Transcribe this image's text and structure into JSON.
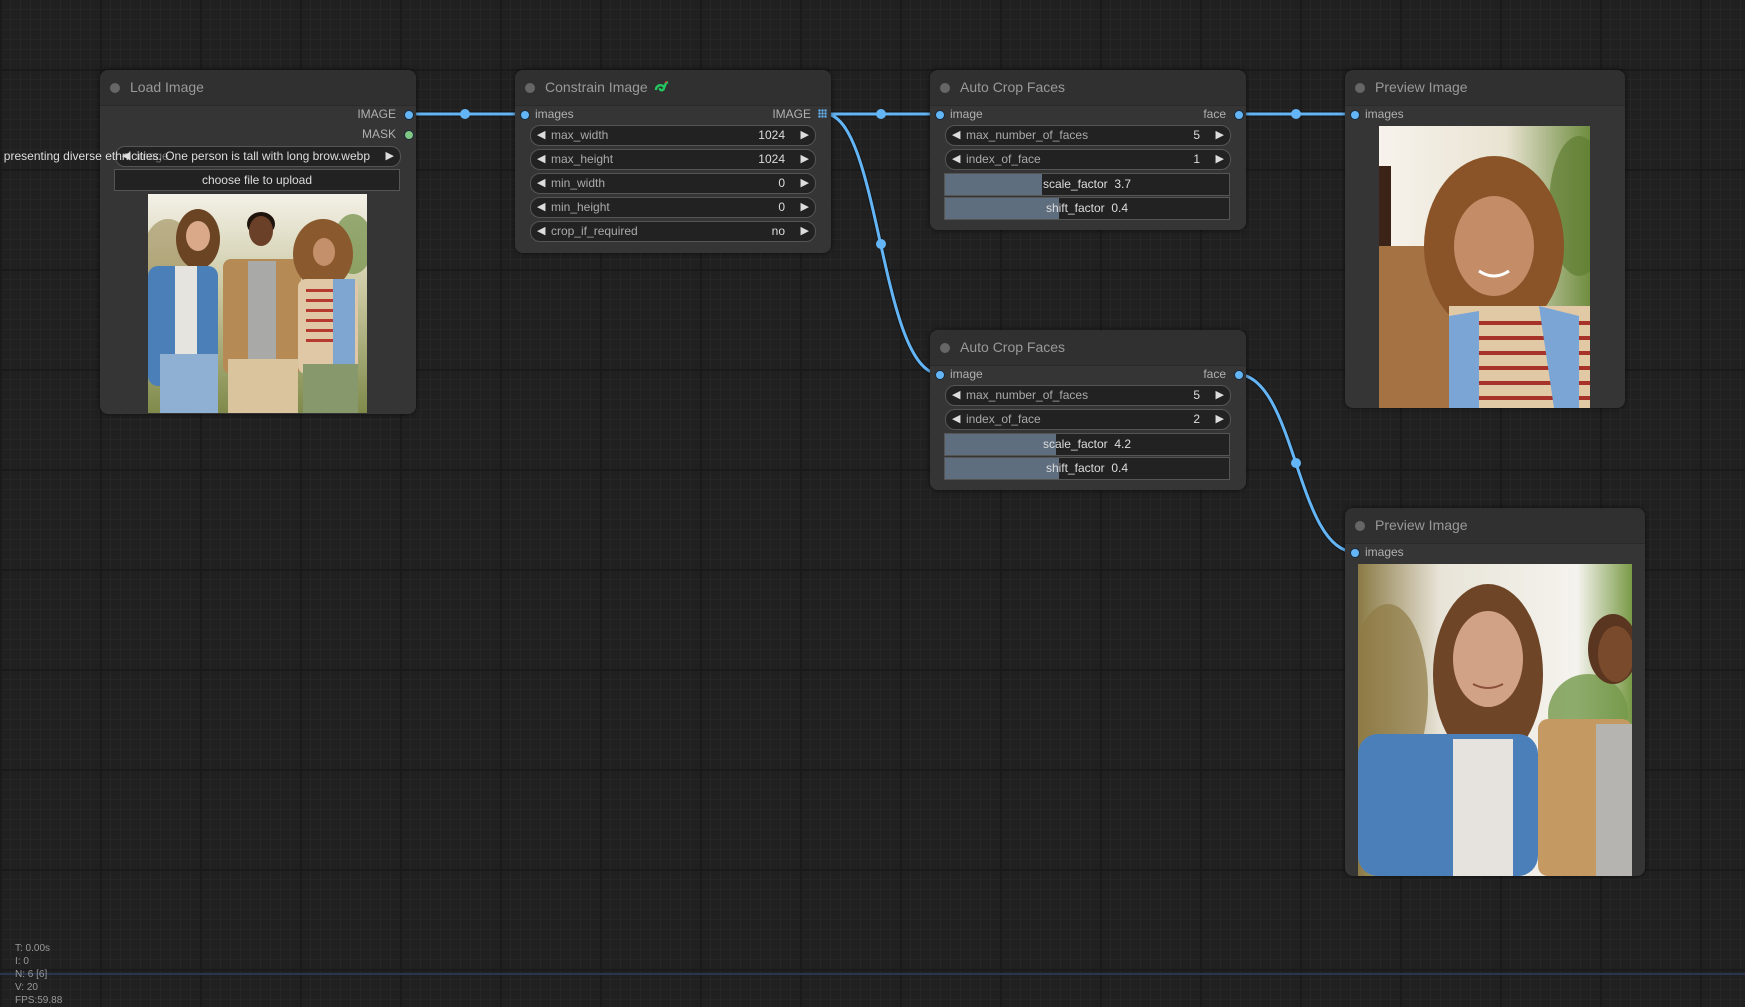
{
  "canvas": {
    "link_color": "#64b5f6",
    "node_bg": "#353535",
    "slider_fill_color": "#5f6e7e"
  },
  "nodes": {
    "load_image": {
      "title": "Load Image",
      "outputs": [
        {
          "label": "IMAGE",
          "color": "#64b5f6"
        },
        {
          "label": "MASK",
          "color": "#81c784"
        }
      ],
      "image_widget": {
        "label": "image",
        "value": "presenting diverse ethnicities. One person is tall with long brow.webp"
      },
      "upload_button": "choose file to upload",
      "preview_alt": "Three young people standing together outdoors"
    },
    "constrain_image": {
      "title": "Constrain Image",
      "badge_icon": "snake-icon",
      "inputs": [
        {
          "label": "images"
        }
      ],
      "outputs": [
        {
          "label": "IMAGE",
          "icon": "list-grid-icon"
        }
      ],
      "widgets": [
        {
          "label": "max_width",
          "value": "1024"
        },
        {
          "label": "max_height",
          "value": "1024"
        },
        {
          "label": "min_width",
          "value": "0"
        },
        {
          "label": "min_height",
          "value": "0"
        },
        {
          "label": "crop_if_required",
          "value": "no"
        }
      ]
    },
    "auto_crop_faces_1": {
      "title": "Auto Crop Faces",
      "inputs": [
        {
          "label": "image"
        }
      ],
      "outputs": [
        {
          "label": "face"
        }
      ],
      "widgets": [
        {
          "label": "max_number_of_faces",
          "value": "5"
        },
        {
          "label": "index_of_face",
          "value": "1"
        }
      ],
      "sliders": [
        {
          "label": "scale_factor",
          "value": "3.7",
          "fill_fraction": 0.34
        },
        {
          "label": "shift_factor",
          "value": "0.4",
          "fill_fraction": 0.4
        }
      ]
    },
    "auto_crop_faces_2": {
      "title": "Auto Crop Faces",
      "inputs": [
        {
          "label": "image"
        }
      ],
      "outputs": [
        {
          "label": "face"
        }
      ],
      "widgets": [
        {
          "label": "max_number_of_faces",
          "value": "5"
        },
        {
          "label": "index_of_face",
          "value": "2"
        }
      ],
      "sliders": [
        {
          "label": "scale_factor",
          "value": "4.2",
          "fill_fraction": 0.39
        },
        {
          "label": "shift_factor",
          "value": "0.4",
          "fill_fraction": 0.4
        }
      ]
    },
    "preview_image_1": {
      "title": "Preview Image",
      "inputs": [
        {
          "label": "images"
        }
      ],
      "preview_alt": "Cropped face: woman with curly hair and striped shirt"
    },
    "preview_image_2": {
      "title": "Preview Image",
      "inputs": [
        {
          "label": "images"
        }
      ],
      "preview_alt": "Cropped face: man with long brown hair and denim jacket"
    }
  },
  "stats": {
    "t": "T: 0.00s",
    "i": "I: 0",
    "n": "N: 6 [6]",
    "v": "V: 20",
    "fps": "FPS:59.88"
  }
}
